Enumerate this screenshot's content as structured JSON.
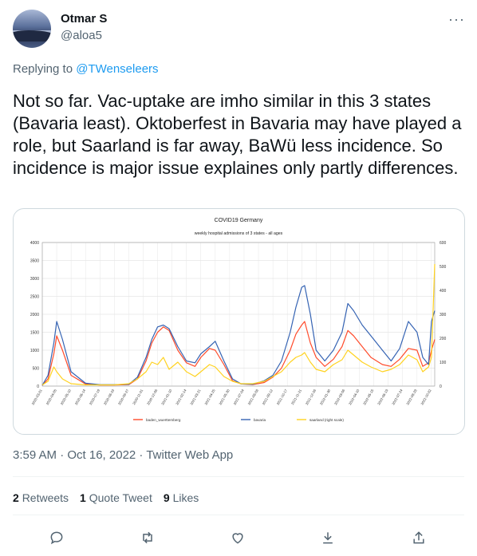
{
  "tweet": {
    "name": "Otmar S",
    "handle": "@aloa5",
    "reply_prefix": "Replying to",
    "reply_to": "@TWenseleers",
    "text": "Not so far. Vac-uptake are imho similar in this 3 states (Bavaria least). Oktoberfest in Bavaria may have played a role, but Saarland is far away, BaWü less incidence. So incidence is major issue explaines only partly differences.",
    "meta": "3:59 AM · Oct 16, 2022 · Twitter Web App",
    "stats": {
      "retweets_count": "2",
      "retweets_label": "Retweets",
      "quotes_count": "1",
      "quotes_label": "Quote Tweet",
      "likes_count": "9",
      "likes_label": "Likes"
    },
    "actions": [
      "reply-icon",
      "retweet-icon",
      "like-icon",
      "bookmark-icon",
      "share-icon"
    ]
  },
  "chart_data": {
    "type": "line",
    "title": "COVID19 Germany",
    "subtitle": "weekly hospital admissions of 3 states - all ages",
    "ylim": [
      0,
      4000
    ],
    "y_ticks": [
      0,
      500,
      1000,
      1500,
      2000,
      2500,
      3000,
      3500,
      4000
    ],
    "y2lim": [
      0,
      600
    ],
    "y2_ticks": [
      0,
      100,
      200,
      300,
      400,
      500,
      600
    ],
    "grid": true,
    "legend_position": "bottom",
    "x_start": "2020-03-01",
    "x_end": "2022-10-10",
    "x_ticks": [
      "2020-03-01",
      "2020-04-05",
      "2020-05-10",
      "2020-06-14",
      "2020-07-19",
      "2020-08-23",
      "2020-09-27",
      "2020-11-01",
      "2020-12-06",
      "2021-01-10",
      "2021-02-14",
      "2021-03-21",
      "2021-04-25",
      "2021-05-30",
      "2021-07-04",
      "2021-08-08",
      "2021-09-12",
      "2021-10-17",
      "2021-11-21",
      "2021-12-26",
      "2022-01-30",
      "2022-03-06",
      "2022-04-10",
      "2022-05-15",
      "2022-06-19",
      "2022-07-24",
      "2022-08-28",
      "2022-10-02"
    ],
    "series": [
      {
        "name": "baden_wuerttemberg",
        "color": "#ff4b2b",
        "axis": "left",
        "x": [
          "2020-03-01",
          "2020-03-15",
          "2020-03-29",
          "2020-04-05",
          "2020-04-19",
          "2020-05-10",
          "2020-06-14",
          "2020-07-19",
          "2020-08-23",
          "2020-09-27",
          "2020-10-18",
          "2020-11-08",
          "2020-11-22",
          "2020-12-06",
          "2020-12-20",
          "2021-01-03",
          "2021-01-24",
          "2021-02-14",
          "2021-03-07",
          "2021-03-21",
          "2021-04-11",
          "2021-04-25",
          "2021-05-16",
          "2021-06-06",
          "2021-06-27",
          "2021-07-25",
          "2021-08-22",
          "2021-09-12",
          "2021-10-03",
          "2021-10-24",
          "2021-11-07",
          "2021-11-21",
          "2021-11-28",
          "2021-12-12",
          "2021-12-26",
          "2022-01-16",
          "2022-02-06",
          "2022-02-27",
          "2022-03-13",
          "2022-03-27",
          "2022-04-17",
          "2022-05-08",
          "2022-06-05",
          "2022-06-26",
          "2022-07-17",
          "2022-08-07",
          "2022-08-28",
          "2022-09-11",
          "2022-09-25",
          "2022-10-02",
          "2022-10-10"
        ],
        "y": [
          20,
          200,
          900,
          1400,
          1000,
          300,
          60,
          30,
          30,
          40,
          200,
          700,
          1200,
          1500,
          1650,
          1550,
          1000,
          650,
          550,
          800,
          1050,
          1000,
          600,
          150,
          60,
          40,
          100,
          250,
          500,
          1000,
          1450,
          1700,
          1800,
          1200,
          800,
          550,
          750,
          1100,
          1550,
          1400,
          1100,
          800,
          600,
          550,
          750,
          1050,
          1000,
          550,
          650,
          1000,
          1300
        ]
      },
      {
        "name": "bavaria",
        "color": "#3563b3",
        "axis": "left",
        "x": [
          "2020-03-01",
          "2020-03-15",
          "2020-03-29",
          "2020-04-05",
          "2020-04-19",
          "2020-05-10",
          "2020-06-14",
          "2020-07-19",
          "2020-08-23",
          "2020-09-27",
          "2020-10-18",
          "2020-11-08",
          "2020-11-22",
          "2020-12-06",
          "2020-12-20",
          "2021-01-03",
          "2021-01-24",
          "2021-02-14",
          "2021-03-07",
          "2021-03-21",
          "2021-04-11",
          "2021-04-25",
          "2021-05-16",
          "2021-06-06",
          "2021-06-27",
          "2021-07-25",
          "2021-08-22",
          "2021-09-12",
          "2021-10-03",
          "2021-10-24",
          "2021-11-07",
          "2021-11-21",
          "2021-11-28",
          "2021-12-12",
          "2021-12-26",
          "2022-01-16",
          "2022-02-06",
          "2022-02-27",
          "2022-03-13",
          "2022-03-27",
          "2022-04-17",
          "2022-05-08",
          "2022-06-05",
          "2022-06-26",
          "2022-07-17",
          "2022-08-07",
          "2022-08-28",
          "2022-09-11",
          "2022-09-25",
          "2022-10-02",
          "2022-10-10"
        ],
        "y": [
          20,
          300,
          1200,
          1800,
          1300,
          400,
          80,
          40,
          40,
          50,
          250,
          800,
          1300,
          1650,
          1700,
          1600,
          1100,
          700,
          650,
          900,
          1100,
          1250,
          700,
          200,
          60,
          50,
          150,
          300,
          700,
          1500,
          2200,
          2750,
          2800,
          2000,
          1000,
          700,
          1000,
          1500,
          2300,
          2100,
          1700,
          1400,
          1000,
          700,
          1050,
          1800,
          1500,
          800,
          600,
          1800,
          2100
        ]
      },
      {
        "name": "saarland (right scale)",
        "color": "#ffd21f",
        "axis": "right",
        "x": [
          "2020-03-01",
          "2020-03-15",
          "2020-03-29",
          "2020-04-05",
          "2020-04-19",
          "2020-05-10",
          "2020-06-14",
          "2020-07-19",
          "2020-08-23",
          "2020-09-27",
          "2020-10-18",
          "2020-11-08",
          "2020-11-22",
          "2020-12-06",
          "2020-12-20",
          "2021-01-03",
          "2021-01-24",
          "2021-02-14",
          "2021-03-07",
          "2021-03-21",
          "2021-04-11",
          "2021-04-25",
          "2021-05-16",
          "2021-06-06",
          "2021-06-27",
          "2021-07-25",
          "2021-08-22",
          "2021-09-12",
          "2021-10-03",
          "2021-10-24",
          "2021-11-07",
          "2021-11-21",
          "2021-11-28",
          "2021-12-12",
          "2021-12-26",
          "2022-01-16",
          "2022-02-06",
          "2022-02-27",
          "2022-03-13",
          "2022-03-27",
          "2022-04-17",
          "2022-05-08",
          "2022-06-05",
          "2022-06-26",
          "2022-07-17",
          "2022-08-07",
          "2022-08-28",
          "2022-09-11",
          "2022-09-25",
          "2022-10-02",
          "2022-10-10"
        ],
        "y": [
          5,
          20,
          80,
          60,
          30,
          10,
          5,
          5,
          5,
          10,
          30,
          60,
          100,
          90,
          120,
          70,
          100,
          60,
          40,
          60,
          90,
          80,
          40,
          20,
          10,
          10,
          20,
          40,
          60,
          100,
          120,
          130,
          140,
          100,
          70,
          60,
          90,
          110,
          150,
          130,
          100,
          80,
          60,
          70,
          90,
          130,
          110,
          60,
          80,
          120,
          510
        ]
      }
    ]
  }
}
